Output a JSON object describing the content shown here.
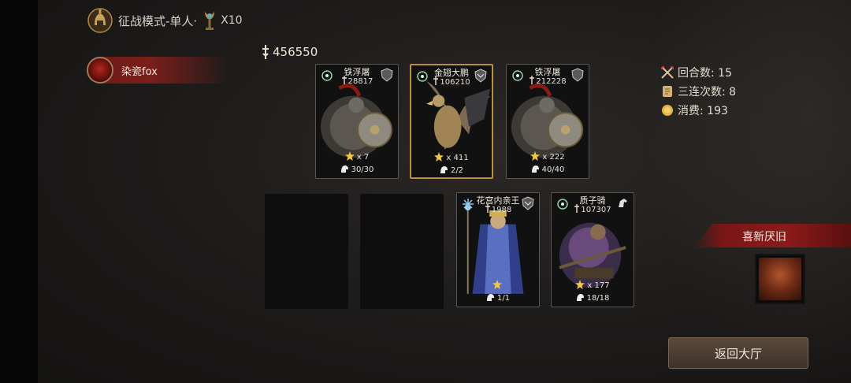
{
  "header": {
    "mode_title": "征战模式-单人·",
    "trophy_count": "X10",
    "mode_icon": "spartan-helmet-icon",
    "trophy_icon": "torch-trophy-icon"
  },
  "player": {
    "name": "染瓷fox",
    "avatar_icon": "demon-avatar-icon"
  },
  "power": {
    "value": "456550",
    "icon": "power-icon"
  },
  "stats": {
    "rounds": "回合数: 15",
    "triple_streak": "三连次数: 8",
    "consumption": "消费: 193"
  },
  "cards_top": [
    {
      "name": "铁浮屠",
      "power": "28817",
      "stars": "x 7",
      "hp": "30/30",
      "highlighted": false
    },
    {
      "name": "金翅大鹏",
      "power": "106210",
      "stars": "x 411",
      "hp": "2/2",
      "highlighted": true
    },
    {
      "name": "铁浮屠",
      "power": "212228",
      "stars": "x 222",
      "hp": "40/40",
      "highlighted": false
    }
  ],
  "cards_bottom": [
    {
      "name": "花宫内亲王",
      "power": "1988",
      "stars": "",
      "hp": "1/1",
      "highlighted": false
    },
    {
      "name": "质子骑",
      "power": "107307",
      "stars": "x 177",
      "hp": "18/18",
      "highlighted": false
    }
  ],
  "side": {
    "banner_label": "喜新厌旧",
    "reward_icon": "warrior-portrait-icon"
  },
  "buttons": {
    "back_label": "返回大厅"
  },
  "colors": {
    "gold": "#b8913b",
    "banner_red": "#8a1b1a",
    "button": "#4a3c31"
  }
}
